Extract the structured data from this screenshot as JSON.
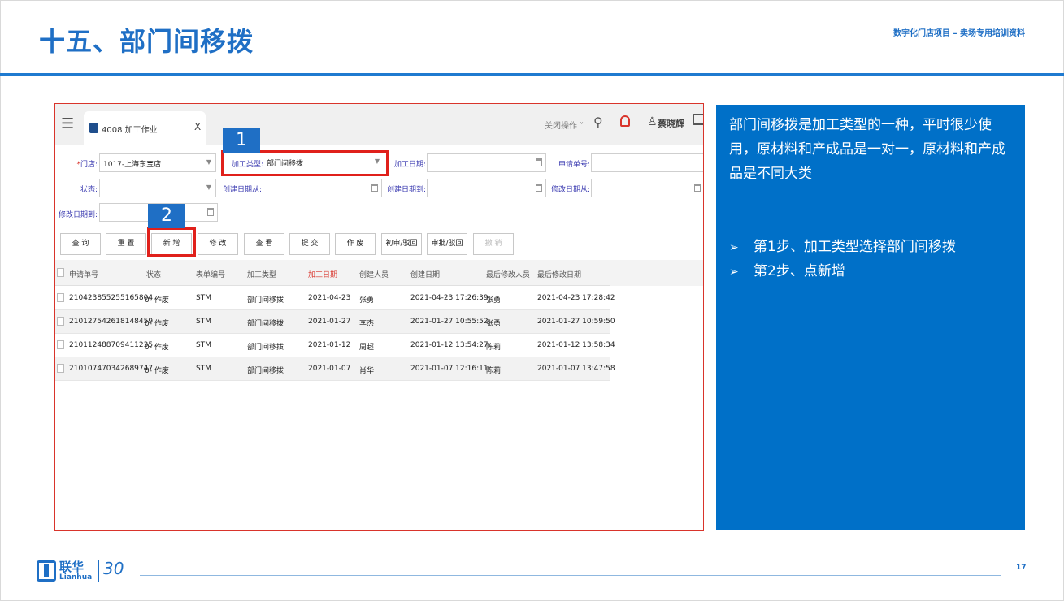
{
  "slide": {
    "title": "十五、部门间移拨",
    "subtitle": "数字化门店项目 – 卖场专用培训资料",
    "page_number": "17"
  },
  "app": {
    "tab_title": "4008 加工作业",
    "tab_close": "X",
    "close_ops": "关闭操作 ˅",
    "user_name": "蔡晓辉"
  },
  "filters": {
    "store_label": "门店:",
    "store_value": "1017-上海东宝店",
    "type_label": "加工类型:",
    "type_value": "部门间移拨",
    "process_date_label": "加工日期:",
    "request_no_label": "申请单号:",
    "status_label": "状态:",
    "created_from_label": "创建日期从:",
    "created_to_label": "创建日期到:",
    "modified_from_label": "修改日期从:",
    "modified_to_label": "修改日期到:"
  },
  "steps": {
    "step1": "1",
    "step2": "2"
  },
  "buttons": {
    "query": "查 询",
    "reset": "重 置",
    "add": "新 增",
    "edit": "修 改",
    "view": "查 看",
    "submit": "提 交",
    "void": "作 废",
    "first_review": "初审/驳回",
    "approve": "审批/驳回",
    "revoke": "撤 销"
  },
  "table": {
    "headers": [
      "申请单号",
      "状态",
      "表单编号",
      "加工类型",
      "加工日期",
      "创建人员",
      "创建日期",
      "最后修改人员",
      "最后修改日期"
    ],
    "rows": [
      [
        "210423855255165804...",
        "0- 作废",
        "STM",
        "部门间移拨",
        "2021-04-23",
        "张勇",
        "2021-04-23 17:26:39",
        "张勇",
        "2021-04-23 17:28:42"
      ],
      [
        "210127542618148459...",
        "0- 作废",
        "STM",
        "部门间移拨",
        "2021-01-27",
        "李杰",
        "2021-01-27 10:55:52",
        "张勇",
        "2021-01-27 10:59:50"
      ],
      [
        "210112488709411235...",
        "0- 作废",
        "STM",
        "部门间移拨",
        "2021-01-12",
        "周超",
        "2021-01-12 13:54:27",
        "陈莉",
        "2021-01-12 13:58:34"
      ],
      [
        "210107470342689747...",
        "0- 作废",
        "STM",
        "部门间移拨",
        "2021-01-07",
        "肖华",
        "2021-01-07 12:16:11",
        "陈莉",
        "2021-01-07 13:47:58"
      ]
    ]
  },
  "info": {
    "description": "部门间移拨是加工类型的一种，平时很少使用，原材料和产成品是一对一，原材料和产成品是不同大类",
    "step1": "第1步、加工类型选择部门间移拨",
    "step2": "第2步、点新增",
    "bullet": "➢"
  },
  "footer": {
    "logo_cn": "联华",
    "logo_en": "Lianhua",
    "logo_30": "30"
  },
  "colors": {
    "brand_blue": "#1f6fc5",
    "panel_blue": "#0070c8",
    "highlight_red": "#e0201b"
  }
}
